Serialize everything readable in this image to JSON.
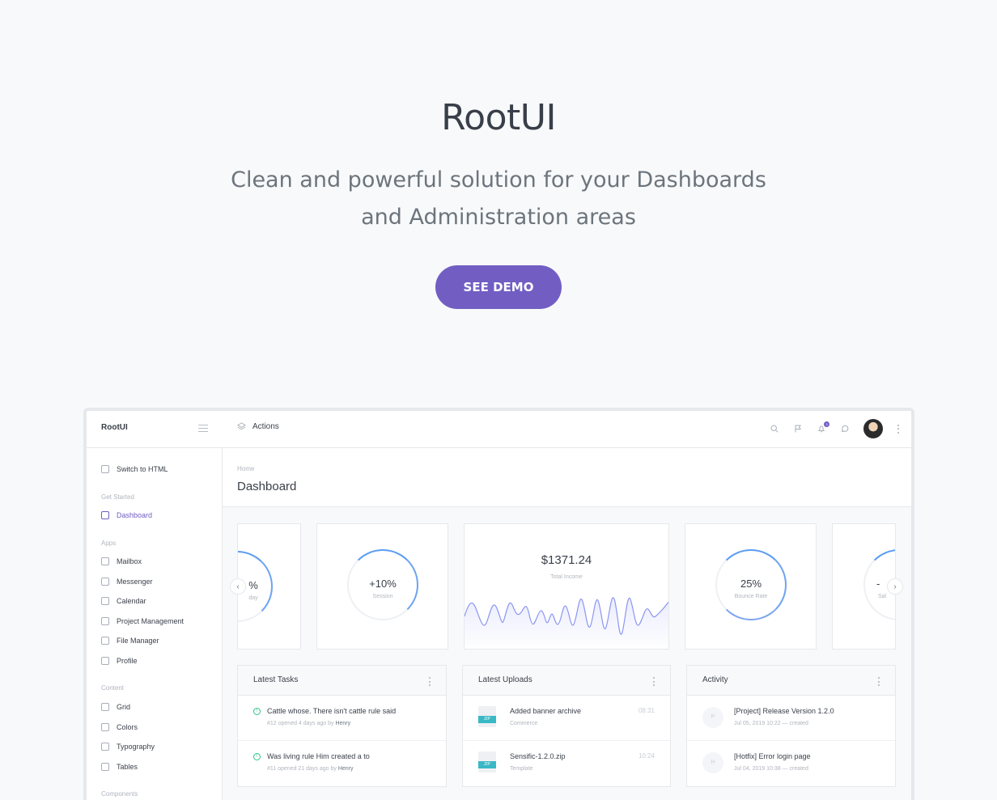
{
  "hero": {
    "title": "RootUI",
    "subtitle_line1": "Clean and powerful solution for your Dashboards",
    "subtitle_line2": "and Administration areas",
    "cta": "SEE DEMO"
  },
  "colors": {
    "accent": "#725ec3",
    "ring": "#5b9cf3",
    "success": "#2fc38a",
    "zip": "#39b8c6"
  },
  "app": {
    "logo": "RootUI",
    "actions_label": "Actions",
    "notification_count": "3"
  },
  "sidebar": {
    "switch": "Switch to HTML",
    "sections": {
      "get_started": "Get Started",
      "apps": "Apps",
      "content": "Content",
      "components": "Components"
    },
    "items": {
      "dashboard": "Dashboard",
      "mailbox": "Mailbox",
      "messenger": "Messenger",
      "calendar": "Calendar",
      "project_management": "Project Management",
      "file_manager": "File Manager",
      "profile": "Profile",
      "grid": "Grid",
      "colors": "Colors",
      "typography": "Typography",
      "tables": "Tables"
    }
  },
  "page": {
    "breadcrumb": "Home",
    "title": "Dashboard"
  },
  "widgets": {
    "left_partial": {
      "value": "%",
      "label": "day"
    },
    "session": {
      "value": "+10%",
      "label": "Session",
      "fraction": 0.35
    },
    "income": {
      "value": "$1371.24",
      "label": "Total Income"
    },
    "bounce": {
      "value": "25%",
      "label": "Bounce Rate",
      "fraction": 0.75
    },
    "right_partial": {
      "value": "-",
      "label": "Sal"
    }
  },
  "tasks": {
    "title": "Latest Tasks",
    "items": [
      {
        "title": "Cattle whose. There isn't cattle rule said",
        "meta": "#12 opened 4 days ago by",
        "author": "Henry"
      },
      {
        "title": "Was living rule Him created a to",
        "meta": "#11 opened 21 days ago by",
        "author": "Henry"
      }
    ]
  },
  "uploads": {
    "title": "Latest Uploads",
    "items": [
      {
        "name": "Added banner archive",
        "category": "Commerce",
        "time": "08:31",
        "type": "ZIP"
      },
      {
        "name": "Sensific-1.2.0.zip",
        "category": "Template",
        "time": "10:24",
        "type": "ZIP"
      }
    ]
  },
  "activity": {
    "title": "Activity",
    "items": [
      {
        "initial": "P",
        "title": "[Project] Release Version 1.2.0",
        "meta": "Jul 05, 2019 10:22 — created"
      },
      {
        "initial": "H",
        "title": "[Hotfix] Error login page",
        "meta": "Jul 04, 2019 10:38 — created"
      }
    ]
  }
}
